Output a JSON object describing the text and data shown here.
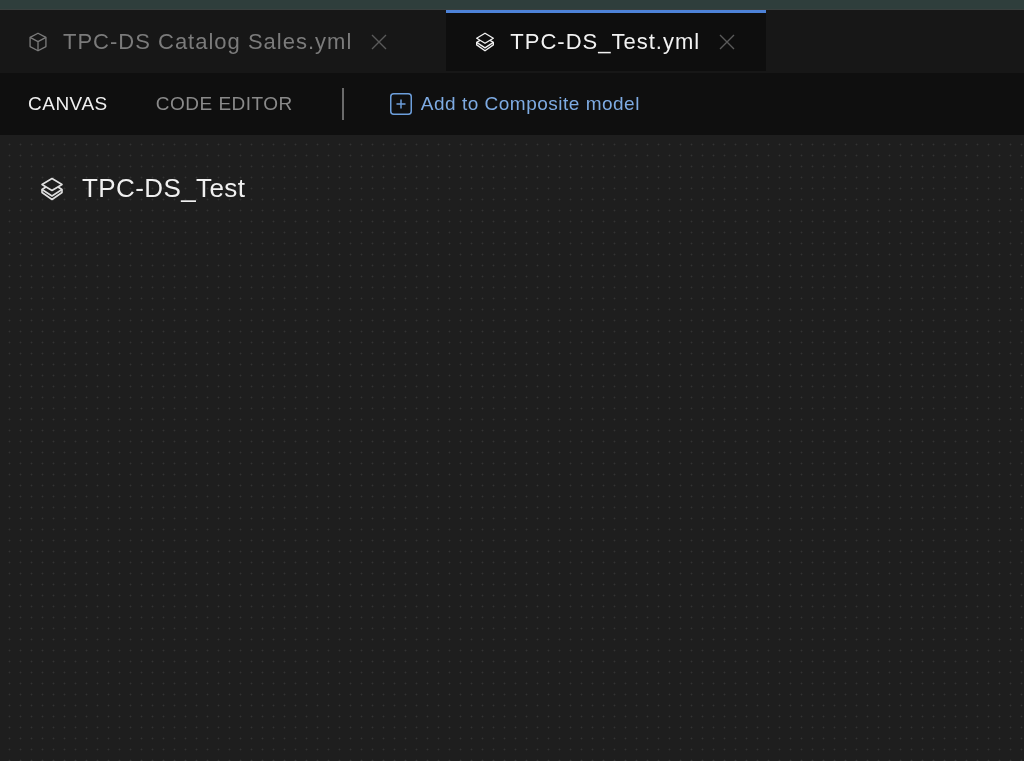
{
  "tabs": [
    {
      "label": "TPC-DS Catalog Sales.yml",
      "kind": "model",
      "selected": false
    },
    {
      "label": "TPC-DS_Test.yml",
      "kind": "composite",
      "selected": true
    }
  ],
  "toolbar": {
    "views": [
      {
        "label": "CANVAS",
        "selected": true
      },
      {
        "label": "CODE EDITOR",
        "selected": false
      }
    ],
    "action": {
      "label": "Add to Composite model"
    }
  },
  "canvas": {
    "title": "TPC-DS_Test",
    "kind": "composite"
  }
}
